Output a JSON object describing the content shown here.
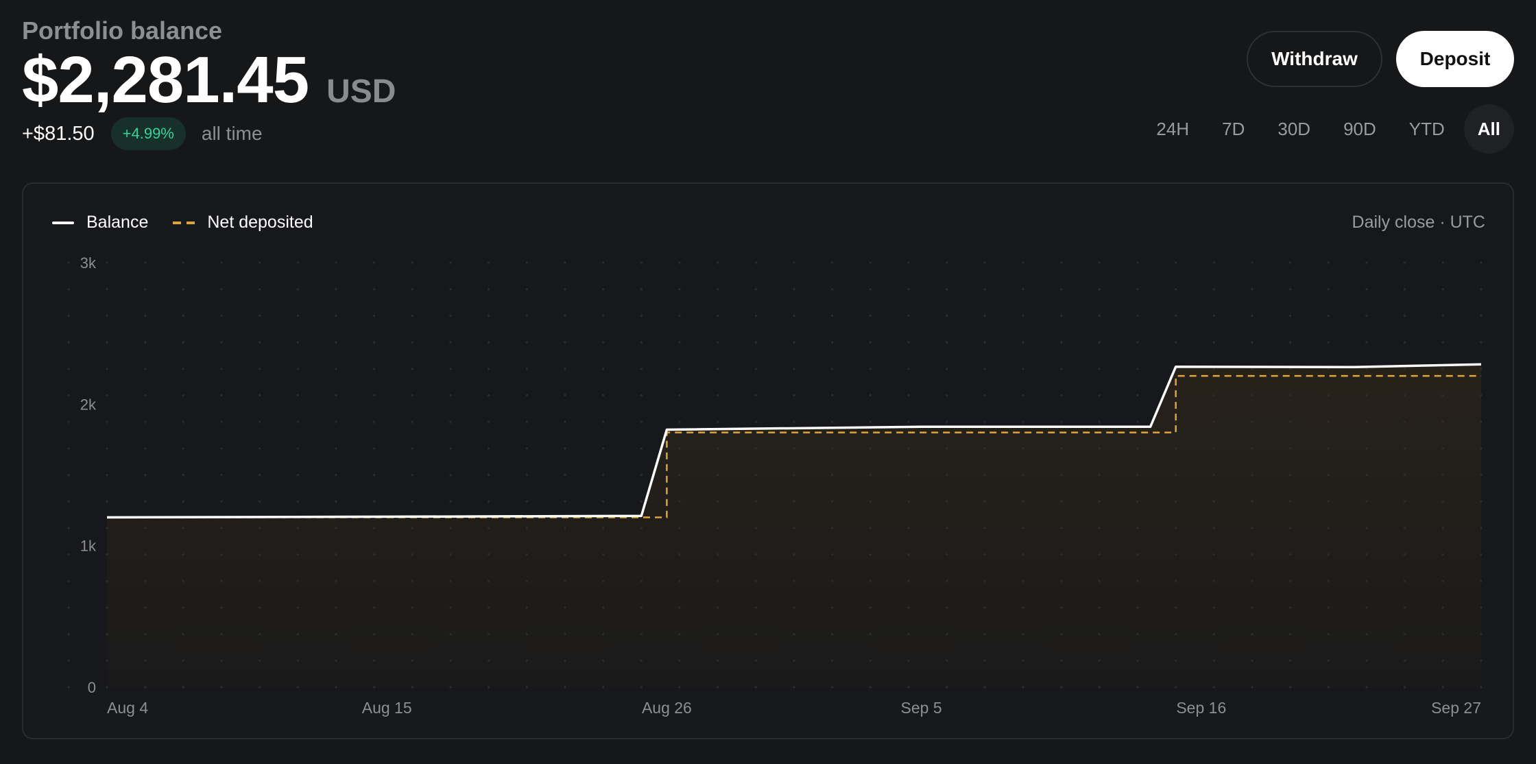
{
  "header": {
    "title": "Portfolio balance",
    "amount": "$2,281.45",
    "currency": "USD",
    "change_abs": "+$81.50",
    "change_pct": "+4.99%",
    "change_period": "all time"
  },
  "actions": {
    "withdraw_label": "Withdraw",
    "deposit_label": "Deposit"
  },
  "ranges": [
    {
      "label": "24H",
      "active": false
    },
    {
      "label": "7D",
      "active": false
    },
    {
      "label": "30D",
      "active": false
    },
    {
      "label": "90D",
      "active": false
    },
    {
      "label": "YTD",
      "active": false
    },
    {
      "label": "All",
      "active": true
    }
  ],
  "colors": {
    "background": "#161719",
    "balance_line": "#ffffff",
    "deposit_line": "#e0a53a",
    "positive": "#34d399"
  },
  "chart_data": {
    "type": "line",
    "title": "",
    "note": "Daily close · UTC",
    "xlabel": "",
    "ylabel": "",
    "x_ticks": [
      "Aug 4",
      "Aug 15",
      "Aug 26",
      "Sep 5",
      "Sep 16",
      "Sep 27"
    ],
    "y_ticks": [
      "0",
      "1k",
      "2k",
      "3k"
    ],
    "ylim": [
      0,
      3000
    ],
    "grid": "dotted",
    "legend_position": "top-left",
    "series": [
      {
        "name": "Balance",
        "style": "solid",
        "color": "#ffffff",
        "points": [
          [
            "Aug 4",
            1200
          ],
          [
            "Aug 15",
            1205
          ],
          [
            "Aug 25",
            1210
          ],
          [
            "Aug 26",
            1820
          ],
          [
            "Sep 5",
            1840
          ],
          [
            "Sep 14",
            1840
          ],
          [
            "Sep 15",
            2265
          ],
          [
            "Sep 22",
            2262
          ],
          [
            "Sep 27",
            2281.45
          ]
        ]
      },
      {
        "name": "Net deposited",
        "style": "dashed",
        "color": "#e0a53a",
        "points": [
          [
            "Aug 4",
            1200
          ],
          [
            "Aug 26",
            1200
          ],
          [
            "Aug 26",
            1800
          ],
          [
            "Sep 15",
            1800
          ],
          [
            "Sep 15",
            2200
          ],
          [
            "Sep 27",
            2200
          ]
        ]
      }
    ]
  }
}
